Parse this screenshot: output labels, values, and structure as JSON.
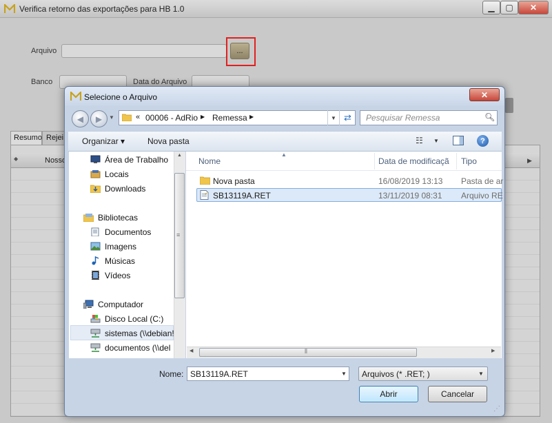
{
  "main_window": {
    "title": "Verifica retorno das exportações para HB 1.0",
    "controls": {
      "minimize": "▁",
      "maximize": "▢",
      "close": "✕"
    },
    "arquivo_label": "Arquivo",
    "browse_label": "...",
    "banco_label": "Banco",
    "data_arquivo_label": "Data do Arquivo",
    "tabs": [
      {
        "label": "Resumo"
      },
      {
        "label": "Rejei"
      }
    ],
    "grid": {
      "column": "Nosso"
    },
    "icons": {
      "logo": "app-logo-icon"
    },
    "colors": {
      "highlight": "#e02020"
    }
  },
  "dialog": {
    "title": "Selecione o Arquivo",
    "close": "✕",
    "address": {
      "chevrons": "«",
      "crumbs": [
        "00006 - AdRio",
        "Remessa"
      ]
    },
    "search_placeholder": "Pesquisar Remessa",
    "toolbar": {
      "organize": "Organizar ▾",
      "new_folder": "Nova pasta"
    },
    "nav": {
      "items": [
        {
          "label": "Área de Trabalho",
          "icon": "desktop-icon"
        },
        {
          "label": "Locais",
          "icon": "places-icon"
        },
        {
          "label": "Downloads",
          "icon": "downloads-folder-icon"
        },
        {
          "label": "Bibliotecas",
          "icon": "libraries-icon"
        },
        {
          "label": "Documentos",
          "icon": "documents-icon"
        },
        {
          "label": "Imagens",
          "icon": "pictures-icon"
        },
        {
          "label": "Músicas",
          "icon": "music-icon"
        },
        {
          "label": "Vídeos",
          "icon": "videos-icon"
        },
        {
          "label": "Computador",
          "icon": "computer-icon"
        },
        {
          "label": "Disco Local (C:)",
          "icon": "local-disk-icon"
        },
        {
          "label": "sistemas (\\\\debian!",
          "icon": "network-drive-icon"
        },
        {
          "label": "documentos (\\\\del",
          "icon": "network-drive-icon"
        }
      ]
    },
    "columns": [
      "Nome",
      "Data de modificaçã",
      "Tipo"
    ],
    "files": [
      {
        "name": "Nova pasta",
        "modified": "16/08/2019 13:13",
        "type": "Pasta de ar",
        "icon": "folder-icon"
      },
      {
        "name": "SB13119A.RET",
        "modified": "13/11/2019 08:31",
        "type": "Arquivo RE",
        "icon": "file-icon"
      }
    ],
    "name_label": "Nome:",
    "name_value": "SB13119A.RET",
    "filetype": "Arquivos (* .RET; )",
    "open_label": "Abrir",
    "cancel_label": "Cancelar",
    "colors": {
      "selection": "#dce9f8",
      "accent": "#3c7fb1"
    }
  }
}
